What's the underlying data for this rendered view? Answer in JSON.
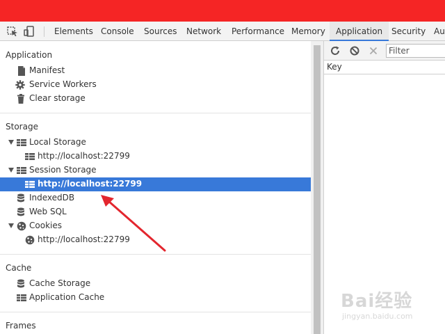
{
  "toolbar": {
    "tabs": [
      {
        "label": "Elements"
      },
      {
        "label": "Console"
      },
      {
        "label": "Sources"
      },
      {
        "label": "Network"
      },
      {
        "label": "Performance"
      },
      {
        "label": "Memory"
      },
      {
        "label": "Application"
      },
      {
        "label": "Security"
      },
      {
        "label": "Au"
      }
    ],
    "active_tab": "Application",
    "icons": [
      "inspect-element-icon",
      "device-toggle-icon"
    ]
  },
  "sidebar": {
    "sections": [
      {
        "title": "Application",
        "items": [
          {
            "label": "Manifest",
            "icon": "document-icon"
          },
          {
            "label": "Service Workers",
            "icon": "gear-icon"
          },
          {
            "label": "Clear storage",
            "icon": "trash-icon"
          }
        ]
      },
      {
        "title": "Storage",
        "items": [
          {
            "label": "Local Storage",
            "icon": "grid-icon",
            "expanded": true
          },
          {
            "label": "http://localhost:22799",
            "icon": "grid-icon"
          },
          {
            "label": "Session Storage",
            "icon": "grid-icon",
            "expanded": true
          },
          {
            "label": "http://localhost:22799",
            "icon": "grid-icon",
            "selected": true
          },
          {
            "label": "IndexedDB",
            "icon": "database-icon"
          },
          {
            "label": "Web SQL",
            "icon": "database-icon"
          },
          {
            "label": "Cookies",
            "icon": "cookie-icon",
            "expanded": true
          },
          {
            "label": "http://localhost:22799",
            "icon": "cookie-icon"
          }
        ]
      },
      {
        "title": "Cache",
        "items": [
          {
            "label": "Cache Storage",
            "icon": "database-icon"
          },
          {
            "label": "Application Cache",
            "icon": "grid-icon"
          }
        ]
      },
      {
        "title": "Frames",
        "items": []
      }
    ]
  },
  "right_panel": {
    "filter_placeholder": "Filter",
    "icons": [
      "refresh-icon",
      "block-icon",
      "delete-icon"
    ],
    "column_header": "Key"
  },
  "watermark": {
    "brand": "Bai经验",
    "url": "jingyan.baidu.com"
  },
  "colors": {
    "banner": "#f52525",
    "selection": "#3879d9",
    "annotation_arrow": "#e3262e"
  }
}
